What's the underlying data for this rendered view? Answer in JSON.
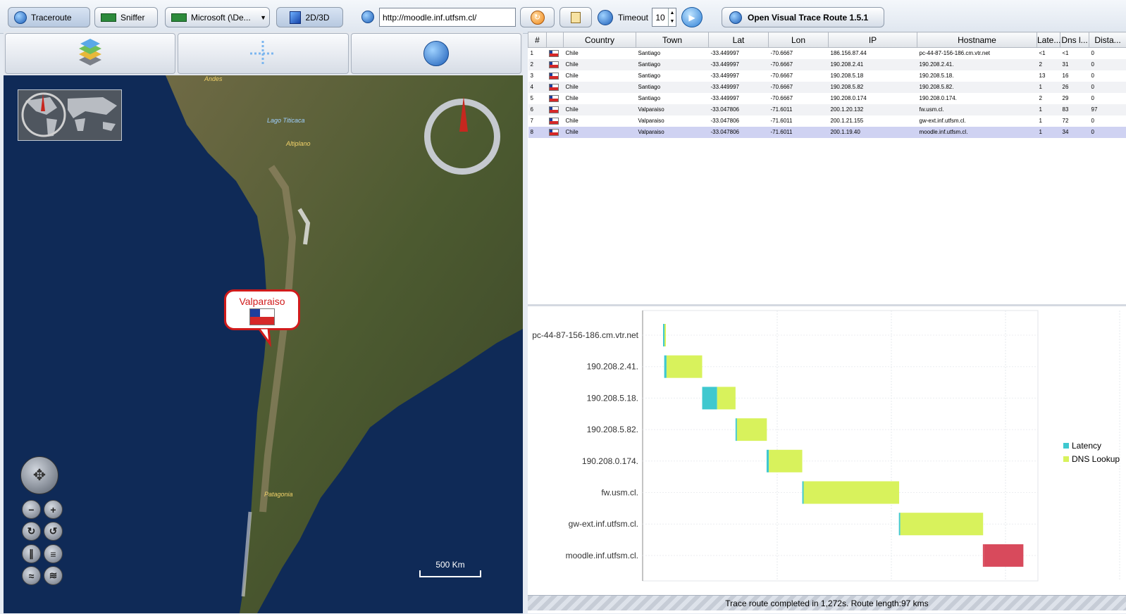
{
  "toolbar": {
    "traceroute_label": "Traceroute",
    "sniffer_label": "Sniffer",
    "device_select": "Microsoft (\\De...",
    "view_toggle_label": "2D/3D",
    "url_value": "http://moodle.inf.utfsm.cl/",
    "timeout_label": "Timeout",
    "timeout_value": "10",
    "app_title": "Open Visual Trace Route 1.5.1"
  },
  "map": {
    "labels": {
      "andes": "Andes",
      "titicaca": "Lago Titicaca",
      "altiplano": "Altiplano",
      "patagonia": "Patagonia"
    },
    "callout_title": "Valparaiso",
    "scale_label": "500 Km"
  },
  "table": {
    "columns": [
      "#",
      "",
      "Country",
      "Town",
      "Lat",
      "Lon",
      "IP",
      "Hostname",
      "Late...",
      "Dns l...",
      "Dista..."
    ],
    "rows": [
      [
        "1",
        "Chile",
        "Santiago",
        "-33.449997",
        "-70.6667",
        "186.156.87.44",
        "pc-44-87-156-186.cm.vtr.net",
        "<1",
        "<1",
        "0"
      ],
      [
        "2",
        "Chile",
        "Santiago",
        "-33.449997",
        "-70.6667",
        "190.208.2.41",
        "190.208.2.41.",
        "2",
        "31",
        "0"
      ],
      [
        "3",
        "Chile",
        "Santiago",
        "-33.449997",
        "-70.6667",
        "190.208.5.18",
        "190.208.5.18.",
        "13",
        "16",
        "0"
      ],
      [
        "4",
        "Chile",
        "Santiago",
        "-33.449997",
        "-70.6667",
        "190.208.5.82",
        "190.208.5.82.",
        "1",
        "26",
        "0"
      ],
      [
        "5",
        "Chile",
        "Santiago",
        "-33.449997",
        "-70.6667",
        "190.208.0.174",
        "190.208.0.174.",
        "2",
        "29",
        "0"
      ],
      [
        "6",
        "Chile",
        "Valparaiso",
        "-33.047806",
        "-71.6011",
        "200.1.20.132",
        "fw.usm.cl.",
        "1",
        "83",
        "97"
      ],
      [
        "7",
        "Chile",
        "Valparaiso",
        "-33.047806",
        "-71.6011",
        "200.1.21.155",
        "gw-ext.inf.utfsm.cl.",
        "1",
        "72",
        "0"
      ],
      [
        "8",
        "Chile",
        "Valparaiso",
        "-33.047806",
        "-71.6011",
        "200.1.19.40",
        "moodle.inf.utfsm.cl.",
        "1",
        "34",
        "0"
      ]
    ],
    "selected_row": 7
  },
  "chart_data": {
    "type": "bar",
    "orientation": "horizontal-gantt",
    "categories": [
      "pc-44-87-156-186.cm.vtr.net",
      "190.208.2.41.",
      "190.208.5.18.",
      "190.208.5.82.",
      "190.208.0.174.",
      "fw.usm.cl.",
      "gw-ext.inf.utfsm.cl.",
      "moodle.inf.utfsm.cl."
    ],
    "series": [
      {
        "name": "Latency",
        "color": "#3fc8cf",
        "values": [
          0.5,
          2,
          13,
          1,
          2,
          1,
          1,
          1
        ]
      },
      {
        "name": "DNS Lookup",
        "color": "#d8f25c",
        "values": [
          0.5,
          31,
          16,
          26,
          29,
          83,
          72,
          34
        ]
      }
    ],
    "last_bar_color": "#d84a5c",
    "legend_position": "right",
    "grid": true
  },
  "status": {
    "text": "Trace route completed in 1,272s. Route length:97 kms"
  }
}
